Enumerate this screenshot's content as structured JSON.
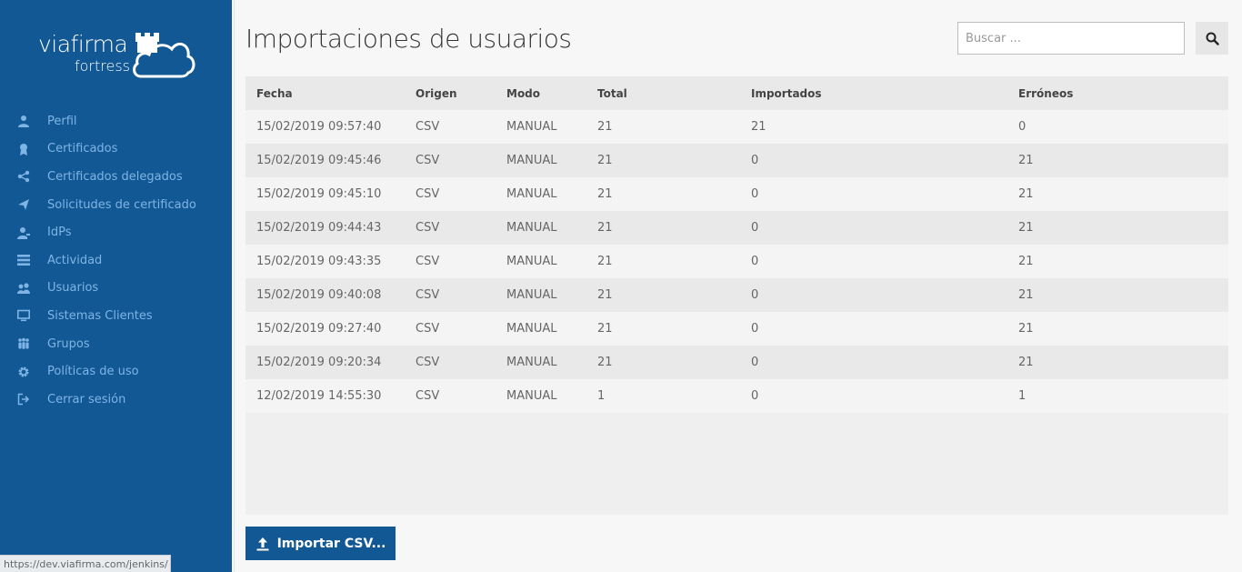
{
  "brand": {
    "name": "viafirma",
    "product": "fortress"
  },
  "sidebar": {
    "items": [
      {
        "label": "Perfil",
        "icon": "user-icon"
      },
      {
        "label": "Certificados",
        "icon": "certificate-icon"
      },
      {
        "label": "Certificados delegados",
        "icon": "share-icon"
      },
      {
        "label": "Solicitudes de certificado",
        "icon": "send-icon"
      },
      {
        "label": "IdPs",
        "icon": "user-key-icon"
      },
      {
        "label": "Actividad",
        "icon": "list-icon"
      },
      {
        "label": "Usuarios",
        "icon": "users-icon"
      },
      {
        "label": "Sistemas Clientes",
        "icon": "monitor-icon"
      },
      {
        "label": "Grupos",
        "icon": "group-icon"
      },
      {
        "label": "Políticas de uso",
        "icon": "gear-icon"
      },
      {
        "label": "Cerrar sesión",
        "icon": "logout-icon"
      }
    ]
  },
  "status_bar": {
    "url": "https://dev.viafirma.com/jenkins/"
  },
  "header": {
    "title": "Importaciones de usuarios"
  },
  "search": {
    "placeholder": "Buscar ..."
  },
  "table": {
    "columns": [
      "Fecha",
      "Origen",
      "Modo",
      "Total",
      "Importados",
      "Erróneos"
    ],
    "rows": [
      [
        "15/02/2019 09:57:40",
        "CSV",
        "MANUAL",
        "21",
        "21",
        "0"
      ],
      [
        "15/02/2019 09:45:46",
        "CSV",
        "MANUAL",
        "21",
        "0",
        "21"
      ],
      [
        "15/02/2019 09:45:10",
        "CSV",
        "MANUAL",
        "21",
        "0",
        "21"
      ],
      [
        "15/02/2019 09:44:43",
        "CSV",
        "MANUAL",
        "21",
        "0",
        "21"
      ],
      [
        "15/02/2019 09:43:35",
        "CSV",
        "MANUAL",
        "21",
        "0",
        "21"
      ],
      [
        "15/02/2019 09:40:08",
        "CSV",
        "MANUAL",
        "21",
        "0",
        "21"
      ],
      [
        "15/02/2019 09:27:40",
        "CSV",
        "MANUAL",
        "21",
        "0",
        "21"
      ],
      [
        "15/02/2019 09:20:34",
        "CSV",
        "MANUAL",
        "21",
        "0",
        "21"
      ],
      [
        "12/02/2019 14:55:30",
        "CSV",
        "MANUAL",
        "1",
        "0",
        "1"
      ]
    ]
  },
  "actions": {
    "import_label": "Importar CSV..."
  },
  "colors": {
    "primary": "#125895",
    "nav_text": "#7fb4e4",
    "page_bg": "#f7f7f7"
  }
}
